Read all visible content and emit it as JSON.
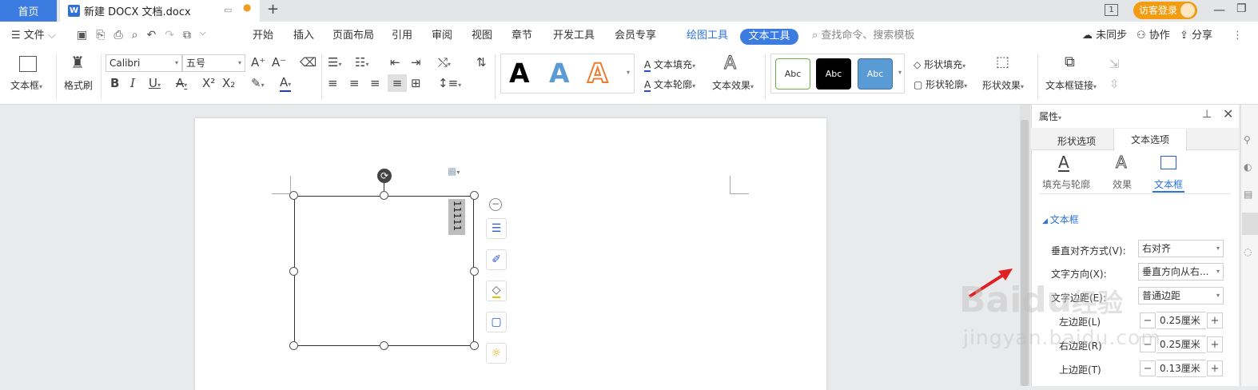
{
  "tabs": {
    "home": "首页",
    "doc_title": "新建 DOCX 文档.docx",
    "add": "+"
  },
  "titlebar_right": {
    "badge": "1",
    "login": "访客登录"
  },
  "menu": {
    "file": "文件",
    "items": [
      "开始",
      "插入",
      "页面布局",
      "引用",
      "审阅",
      "视图",
      "章节",
      "开发工具",
      "会员专享"
    ],
    "drawing_tools": "绘图工具",
    "text_tools": "文本工具",
    "search_placeholder": "查找命令、搜索模板",
    "sync": "未同步",
    "collab": "协作",
    "share": "分享"
  },
  "ribbon": {
    "textbox": "文本框",
    "format_painter": "格式刷",
    "font_name": "Calibri",
    "font_size": "五号",
    "text_fill": "文本填充",
    "text_outline": "文本轮廓",
    "text_effect": "文本效果",
    "shape_fill": "形状填充",
    "shape_outline": "形状轮廓",
    "shape_effect": "形状效果",
    "textbox_link": "文本框链接",
    "style_abc": "Abc"
  },
  "document": {
    "textbox_text": "11111"
  },
  "panel": {
    "title": "属性",
    "tab_shape": "形状选项",
    "tab_text": "文本选项",
    "sub_fill": "填充与轮廓",
    "sub_effect": "效果",
    "sub_textbox": "文本框",
    "section": "文本框",
    "rows": [
      {
        "label": "垂直对齐方式(V):",
        "value": "右对齐"
      },
      {
        "label": "文字方向(X):",
        "value": "垂直方向从右..."
      },
      {
        "label": "文字边距(E):",
        "value": "普通边距"
      },
      {
        "label": "左边距(L)",
        "value": "0.25厘米"
      },
      {
        "label": "右边距(R)",
        "value": "0.25厘米"
      },
      {
        "label": "上边距(T)",
        "value": "0.13厘米"
      }
    ]
  },
  "watermark": {
    "brand": "Baidu",
    "cn": "经验",
    "url": "jingyan.baidu.com"
  }
}
